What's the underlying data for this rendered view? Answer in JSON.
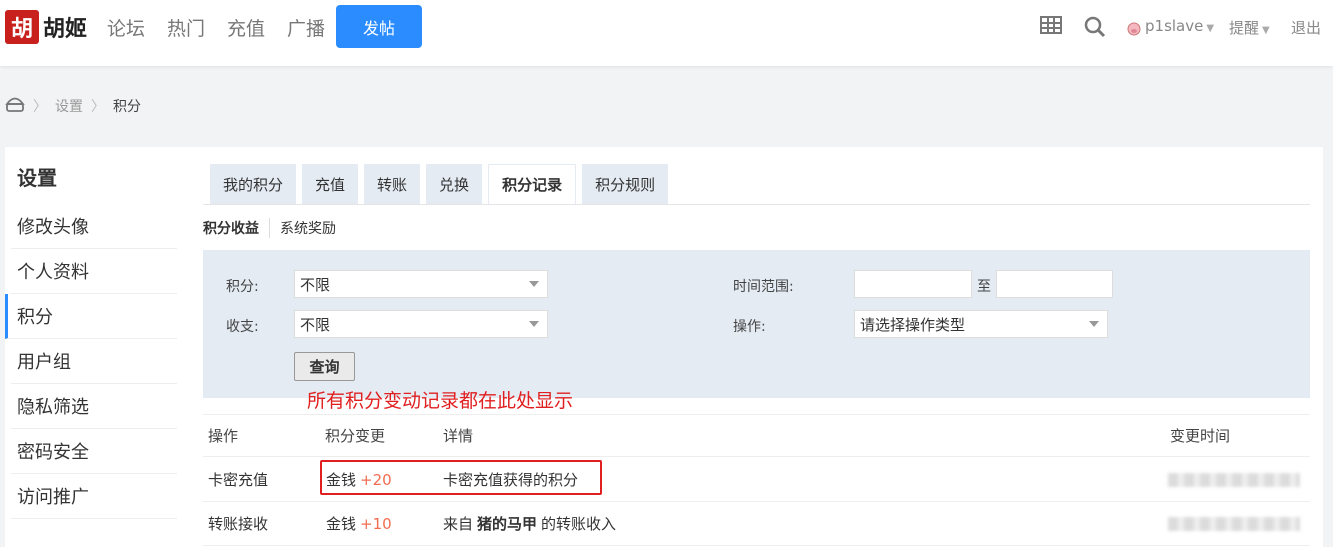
{
  "header": {
    "logo_mark": "胡",
    "logo_text": "胡姬",
    "nav": [
      "论坛",
      "热门",
      "充值",
      "广播"
    ],
    "post_button": "发帖",
    "username": "p1slave",
    "remind": "提醒",
    "logout": "退出",
    "icons": [
      "grid-icon",
      "search-icon",
      "pig-avatar-icon"
    ]
  },
  "breadcrumb": {
    "items": [
      "设置",
      "积分"
    ]
  },
  "sidebar": {
    "title": "设置",
    "items": [
      {
        "label": "修改头像"
      },
      {
        "label": "个人资料"
      },
      {
        "label": "积分",
        "active": true
      },
      {
        "label": "用户组"
      },
      {
        "label": "隐私筛选"
      },
      {
        "label": "密码安全"
      },
      {
        "label": "访问推广"
      }
    ]
  },
  "tabs": [
    "我的积分",
    "充值",
    "转账",
    "兑换",
    "积分记录",
    "积分规则"
  ],
  "active_tab": "积分记录",
  "subtabs": {
    "income": "积分收益",
    "reward": "系统奖励"
  },
  "filter": {
    "credit_label": "积分:",
    "credit_value": "不限",
    "inout_label": "收支:",
    "inout_value": "不限",
    "time_label": "时间范围:",
    "time_sep": "至",
    "op_label": "操作:",
    "op_value": "请选择操作类型",
    "query_button": "查询"
  },
  "annotation": "所有积分变动记录都在此处显示",
  "table": {
    "headers": {
      "op": "操作",
      "change": "积分变更",
      "detail": "详情",
      "time": "变更时间"
    },
    "rows": [
      {
        "op": "卡密充值",
        "currency": "金钱",
        "amount": "+20",
        "detail": "卡密充值获得的积分"
      },
      {
        "op": "转账接收",
        "currency": "金钱",
        "amount": "+10",
        "detail_pre": "来自",
        "detail_user": "猪的马甲",
        "detail_post": "的转账收入"
      }
    ]
  },
  "colors": {
    "accent": "#2a8cff",
    "annotation_red": "#e02020",
    "plus_orange": "#f26c4f"
  }
}
